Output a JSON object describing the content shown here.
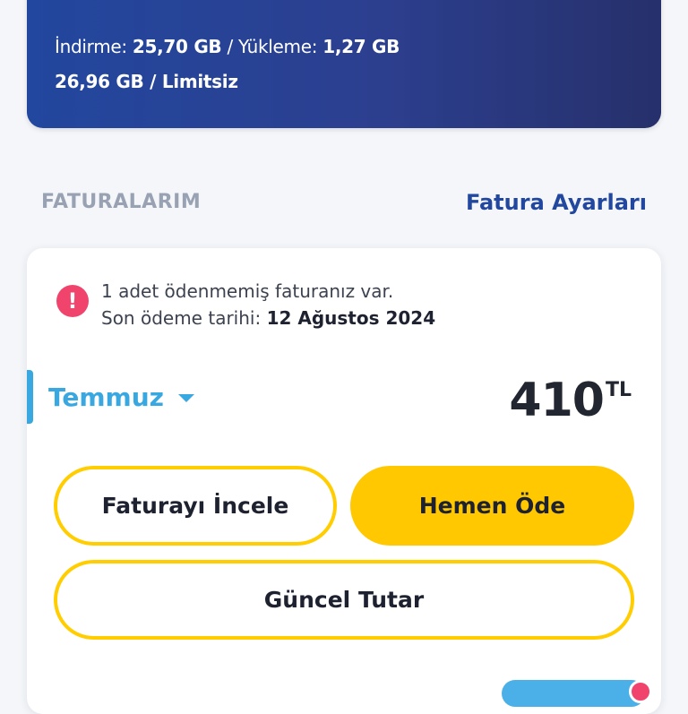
{
  "usage": {
    "download_label": "İndirme:",
    "download_value": "25,70 GB",
    "separator": "/",
    "upload_label": "Yükleme:",
    "upload_value": "1,27 GB",
    "total_line": "26,96 GB / Limitsiz"
  },
  "bills_section": {
    "title": "FATURALARIM",
    "settings_link": "Fatura Ayarları"
  },
  "bill_card": {
    "alert_icon": "exclamation-icon",
    "alert_line1": "1 adet ödenmemiş faturanız var.",
    "alert_line2_label": "Son ödeme tarihi:",
    "alert_line2_date": "12 Ağustos 2024",
    "month": "Temmuz",
    "amount": "410",
    "currency": "TL",
    "review_button": "Faturayı İncele",
    "pay_button": "Hemen Öde",
    "current_amount_button": "Güncel Tutar"
  },
  "colors": {
    "brand_blue": "#22479e",
    "accent_cyan": "#3aa8e0",
    "action_yellow": "#ffc800",
    "alert_pink": "#f0446d"
  }
}
